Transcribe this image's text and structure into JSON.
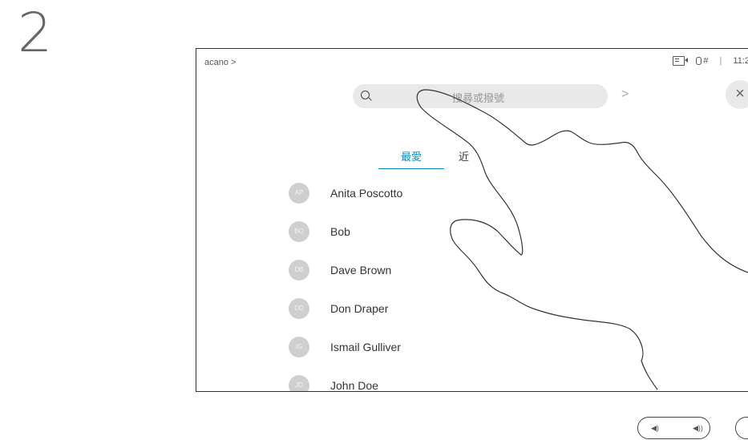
{
  "step_number": "2",
  "header": {
    "brand": "acano",
    "brand_chevron": ">",
    "separator": "|",
    "time": "11:2"
  },
  "search": {
    "placeholder": "搜尋或撥號",
    "chevron": ">"
  },
  "close_label": "×",
  "tabs": [
    {
      "label": "最愛",
      "active": true
    },
    {
      "label": "近",
      "active": false
    }
  ],
  "contacts": [
    {
      "initials": "AP",
      "name": "Anita Poscotto"
    },
    {
      "initials": "BO",
      "name": "Bob"
    },
    {
      "initials": "DB",
      "name": "Dave Brown"
    },
    {
      "initials": "DD",
      "name": "Don Draper"
    },
    {
      "initials": "IG",
      "name": "Ismail Gulliver"
    },
    {
      "initials": "JD",
      "name": "John Doe"
    }
  ],
  "colors": {
    "accent": "#0b8cc6",
    "avatar": "#cfcfcf",
    "search_bg": "#e9e9e9"
  },
  "icons": {
    "video": "video-icon",
    "mic": "mic-icon",
    "search": "search-icon",
    "close": "close-icon"
  }
}
